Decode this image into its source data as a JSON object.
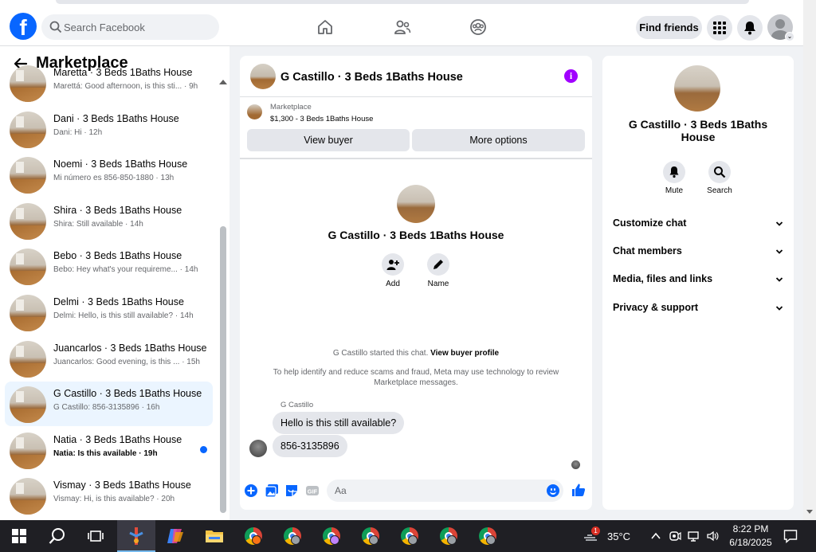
{
  "topbar": {
    "search_placeholder": "Search Facebook",
    "find_friends_label": "Find friends",
    "logo_glyph": "f",
    "nav_icons": [
      "home-icon",
      "friends-icon",
      "groups-icon"
    ],
    "accent_color": "#0866ff"
  },
  "sidebar": {
    "title": "Marketplace",
    "conversations": [
      {
        "title": "Maretta · 3 Beds 1Baths House",
        "preview": "Marettá: Good afternoon, is this sti... · 9h",
        "active": false,
        "unread": false
      },
      {
        "title": "Dani · 3 Beds 1Baths House",
        "preview": "Dani: Hi · 12h",
        "active": false,
        "unread": false
      },
      {
        "title": "Noemi · 3 Beds 1Baths House",
        "preview": "Mi número es 856-850-1880 · 13h",
        "active": false,
        "unread": false
      },
      {
        "title": "Shira · 3 Beds 1Baths House",
        "preview": "Shira: Still available · 14h",
        "active": false,
        "unread": false
      },
      {
        "title": "Bebo · 3 Beds 1Baths House",
        "preview": "Bebo: Hey what's your requireme... · 14h",
        "active": false,
        "unread": false
      },
      {
        "title": "Delmi · 3 Beds 1Baths House",
        "preview": "Delmi: Hello, is this still available? · 14h",
        "active": false,
        "unread": false
      },
      {
        "title": "Juancarlos · 3 Beds 1Baths House",
        "preview": "Juancarlos: Good evening, is this ... · 15h",
        "active": false,
        "unread": false
      },
      {
        "title": "G Castillo · 3 Beds 1Baths House",
        "preview": "G Castillo: 856-3135896 · 16h",
        "active": true,
        "unread": false
      },
      {
        "title": "Natia · 3 Beds 1Baths House",
        "preview": "Natia: Is this available · 19h",
        "active": false,
        "unread": true
      },
      {
        "title": "Vismay · 3 Beds 1Baths House",
        "preview": "Vismay: Hi, is this available? · 20h",
        "active": false,
        "unread": false
      }
    ]
  },
  "chat": {
    "header_title": "G Castillo · 3 Beds 1Baths House",
    "info_glyph": "i",
    "marketplace_label": "Marketplace",
    "listing_price": "$1,300 - 3 Beds 1Baths House",
    "view_buyer_label": "View buyer",
    "more_options_label": "More options",
    "profile_name": "G Castillo · 3 Beds 1Baths House",
    "add_label": "Add",
    "name_label": "Name",
    "started_text": "G Castillo started this chat.",
    "view_profile_link": "View buyer profile",
    "notice": "To help identify and reduce scams and fraud, Meta may use technology to review Marketplace messages.",
    "sender_name": "G Castillo",
    "messages": [
      "Hello is this still available?",
      "856-3135896"
    ],
    "composer_placeholder": "Aa"
  },
  "info_panel": {
    "name": "G Castillo · 3 Beds 1Baths House",
    "mute_label": "Mute",
    "search_label": "Search",
    "sections": [
      "Customize chat",
      "Chat members",
      "Media, files and links",
      "Privacy & support"
    ]
  },
  "taskbar": {
    "weather_temp": "35°C",
    "weather_badge": "1",
    "time": "8:22 PM",
    "date": "6/18/2025"
  }
}
